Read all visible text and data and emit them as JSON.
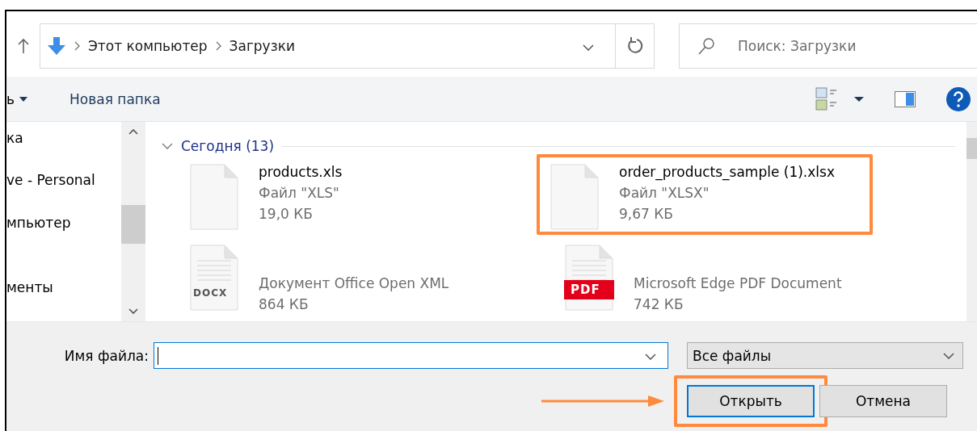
{
  "address_bar": {
    "path": [
      "Этот компьютер",
      "Загрузки"
    ]
  },
  "search": {
    "placeholder": "Поиск: Загрузки"
  },
  "toolbar": {
    "cut_menu": "ь",
    "new_folder": "Новая папка"
  },
  "sidebar": {
    "items": [
      {
        "label": "ка"
      },
      {
        "label": "ve - Personal"
      },
      {
        "label": "мпьютер"
      },
      {
        "label": "менты"
      }
    ]
  },
  "group": {
    "label": "Сегодня (13)",
    "expanded": true
  },
  "files": [
    {
      "name": "products.xls",
      "type": "Файл \"XLS\"",
      "size": "19,0 КБ",
      "kind": "blank",
      "highlighted": false
    },
    {
      "name": "order_products_sample (1).xlsx",
      "type": "Файл \"XLSX\"",
      "size": "9,67 КБ",
      "kind": "blank",
      "highlighted": true
    },
    {
      "type": "Документ Office Open XML",
      "size": "864 КБ",
      "kind": "docx",
      "badge": "DOCX",
      "highlighted": false
    },
    {
      "type": "Microsoft Edge PDF Document",
      "size": "742 КБ",
      "kind": "pdf",
      "badge": "PDF",
      "highlighted": false
    }
  ],
  "filename": {
    "label": "Имя файла:"
  },
  "filter": {
    "value": "Все файлы"
  },
  "buttons": [
    {
      "label": "Открыть",
      "kind": "primary",
      "highlighted": true
    },
    {
      "label": "Отмена",
      "kind": "secondary",
      "highlighted": false
    }
  ]
}
